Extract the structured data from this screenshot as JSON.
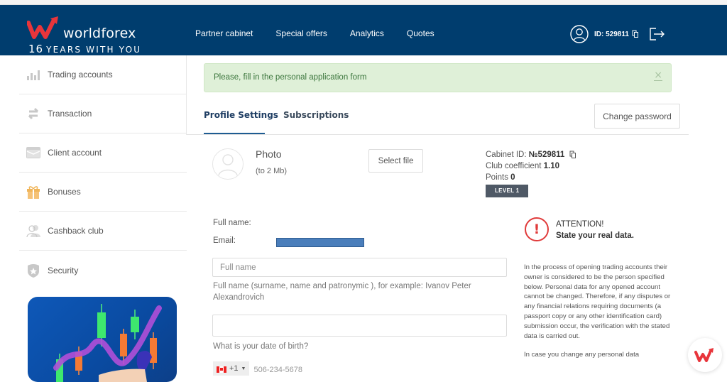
{
  "header": {
    "brand": "worldforex",
    "tagline_num": "16",
    "tagline_text": "YEARS WITH YOU",
    "nav": [
      "Partner cabinet",
      "Special offers",
      "Analytics",
      "Quotes"
    ],
    "user_id": "ID: 529811",
    "icons": [
      "user-circle-icon",
      "copy-icon",
      "logout-icon"
    ]
  },
  "sidebar": {
    "items": [
      {
        "label": "Trading accounts",
        "icon": "bar-chart-icon"
      },
      {
        "label": "Transaction",
        "icon": "transfer-arrows-icon"
      },
      {
        "label": "Client account",
        "icon": "wallet-icon"
      },
      {
        "label": "Bonuses",
        "icon": "gift-icon"
      },
      {
        "label": "Cashback club",
        "icon": "users-icon"
      },
      {
        "label": "Security",
        "icon": "shield-star-icon"
      }
    ]
  },
  "alert": {
    "text": "Please, fill in the personal application form",
    "close": "×"
  },
  "tabs": {
    "items": [
      "Profile Settings",
      "Subscriptions"
    ],
    "active": "Profile Settings",
    "change_password": "Change password"
  },
  "photo": {
    "title": "Photo",
    "subtitle": "(to 2 Mb)",
    "select_file": "Select file"
  },
  "cabinet": {
    "id_label": "Cabinet ID:",
    "id_value": "№529811",
    "club_label": "Club coefficient",
    "club_value": "1.10",
    "points_label": "Points",
    "points_value": "0",
    "level": "LEVEL 1"
  },
  "form": {
    "full_name_label": "Full name:",
    "email_label": "Email:",
    "full_name_placeholder": "Full name",
    "full_name_hint": "Full name (surname, name and patronymic ), for example: Ivanov Peter Alexandrovich",
    "dob_value": "",
    "dob_hint": "What is your date of birth?",
    "phone_code": "+1",
    "phone_placeholder": "506-234-5678"
  },
  "attention": {
    "title": "ATTENTION!",
    "subtitle": "State your real data.",
    "paragraphs": [
      "In the process of opening trading accounts their owner is considered to be the person specified below. Personal data for any opened account cannot be changed. Therefore, if any disputes or any financial relations requiring documents (a passport copy or any other identification card) submission occur, the verification with the stated data is carried out.",
      "In case you change any personal data"
    ]
  },
  "colors": {
    "header_bg": "#003d6e",
    "brand_red": "#e8353b",
    "alert_bg": "#dff0d8",
    "alert_text": "#3c763d",
    "attention_red": "#e03a3a"
  }
}
